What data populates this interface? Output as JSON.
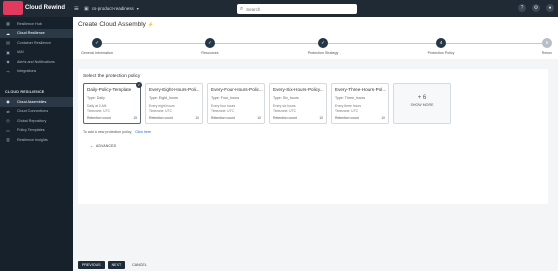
{
  "topbar": {
    "logo_text": "Cloud Rewind",
    "workspace": "cs-product-readiness",
    "search_placeholder": "Search"
  },
  "sidebar": {
    "items": [
      {
        "label": "Resilience Hub",
        "icon": "grid-icon"
      },
      {
        "label": "Cloud Resilience",
        "icon": "cloud-icon"
      },
      {
        "label": "Container Resilience",
        "icon": "container-icon"
      },
      {
        "label": "IAM",
        "icon": "key-icon"
      },
      {
        "label": "Alerts and Notifications",
        "icon": "bell-icon"
      },
      {
        "label": "Integrations",
        "icon": "plug-icon"
      }
    ],
    "section_title": "CLOUD RESILIENCE",
    "section_items": [
      {
        "label": "Cloud Assemblies",
        "icon": "assembly-icon",
        "active": true
      },
      {
        "label": "Cloud Connections",
        "icon": "link-icon"
      },
      {
        "label": "Global Repository",
        "icon": "database-icon"
      },
      {
        "label": "Policy Templates",
        "icon": "document-icon"
      },
      {
        "label": "Resilience Insights",
        "icon": "chart-icon"
      }
    ]
  },
  "page": {
    "title": "Create Cloud Assembly",
    "title_tag": "⚡"
  },
  "stepper": {
    "steps": [
      {
        "label": "General Information",
        "state": "done",
        "mark": "✓"
      },
      {
        "label": "Resources",
        "state": "done",
        "mark": "✓"
      },
      {
        "label": "Protection Strategy",
        "state": "done",
        "mark": "✓"
      },
      {
        "label": "Protection Policy",
        "state": "current",
        "mark": "4"
      },
      {
        "label": "Recov",
        "state": "pending",
        "mark": "5"
      }
    ]
  },
  "policy": {
    "prompt": "Select the protection policy",
    "cards": [
      {
        "title": "Daily-Policy-Template",
        "type": "Type: Daily",
        "desc": [
          "Daily at 0 AM",
          "Timezone: UTC"
        ],
        "retention_label": "Retention count",
        "retention": "15",
        "selected": true
      },
      {
        "title": "Every-Eight-Hours-Poli...",
        "type": "Type: Eight_hours",
        "desc": [
          "Every eight hours",
          "Timezone: UTC"
        ],
        "retention_label": "Retention count",
        "retention": "10",
        "selected": false
      },
      {
        "title": "Every-Four-Hours-Polic...",
        "type": "Type: Four_hours",
        "desc": [
          "Every four hours",
          "Timezone: UTC"
        ],
        "retention_label": "Retention count",
        "retention": "10",
        "selected": false
      },
      {
        "title": "Every-Six-Hours-Policy...",
        "type": "Type: Six_hours",
        "desc": [
          "Every six hours",
          "Timezone: UTC"
        ],
        "retention_label": "Retention count",
        "retention": "10",
        "selected": false
      },
      {
        "title": "Every-Three-Hours-Pol...",
        "type": "Type: Three_hours",
        "desc": [
          "Every three hours",
          "Timezone: UTC"
        ],
        "retention_label": "Retention count",
        "retention": "10",
        "selected": false
      }
    ],
    "more_count": "+ 6",
    "more_label": "SHOW MORE",
    "add_note": "To add a new protection policy,",
    "add_link": "Click here",
    "advanced": "ADVANCED"
  },
  "footer": {
    "previous": "PREVIOUS",
    "next": "NEXT",
    "cancel": "CANCEL"
  }
}
